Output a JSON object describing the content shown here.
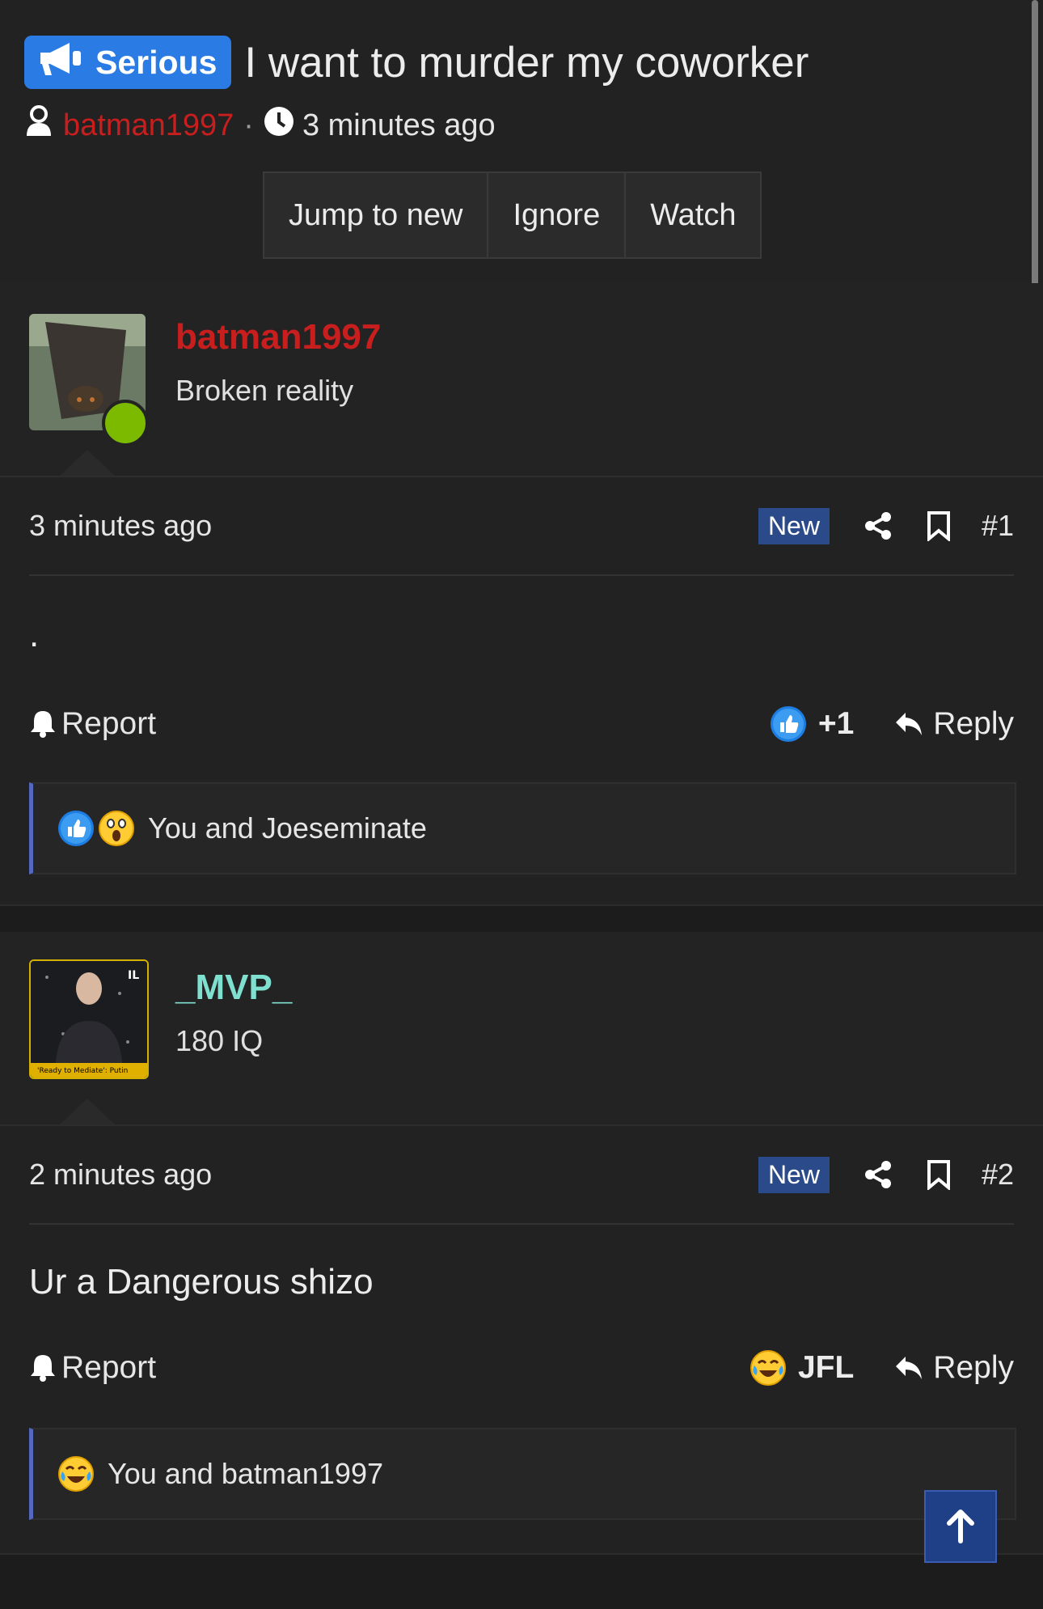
{
  "thread": {
    "prefix": "Serious",
    "title": "I want to murder my coworker",
    "author": "batman1997",
    "separator": "·",
    "time": "3 minutes ago",
    "buttons": [
      "Jump to new",
      "Ignore",
      "Watch"
    ]
  },
  "posts": [
    {
      "username": "batman1997",
      "username_color": "#c81e1e",
      "user_title": "Broken reality",
      "time": "3 minutes ago",
      "badge": "New",
      "number": "#1",
      "body": ".",
      "report_label": "Report",
      "reaction_label": "+1",
      "reaction_icon": "like-icon",
      "reply_label": "Reply",
      "reactions_text": "You and Joeseminate",
      "reactions_icons": [
        "like-icon",
        "wow-icon"
      ]
    },
    {
      "username": "_MVP_",
      "username_color": "#7fe0d0",
      "user_title": "180 IQ",
      "avatar_badge": "IL",
      "avatar_caption": "'Ready to Mediate': Putin",
      "time": "2 minutes ago",
      "badge": "New",
      "number": "#2",
      "body": "Ur a Dangerous shizo",
      "report_label": "Report",
      "reaction_label": "JFL",
      "reaction_icon": "laughing-crying-icon",
      "reply_label": "Reply",
      "reactions_text": "You and batman1997",
      "reactions_icons": [
        "laughing-crying-icon"
      ]
    }
  ],
  "colors": {
    "accent": "#2a7be4",
    "new_badge": "#2a4a8a",
    "online": "#7cba00"
  }
}
